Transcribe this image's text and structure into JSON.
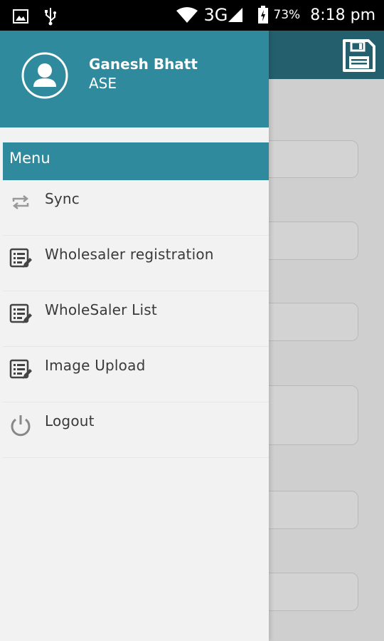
{
  "status_bar": {
    "network": "3G",
    "battery": "73%",
    "time": "8:18 pm"
  },
  "user": {
    "name": "Ganesh Bhatt",
    "role": "ASE"
  },
  "menu": {
    "title": "Menu",
    "items": [
      {
        "label": "Sync",
        "icon": "sync-icon"
      },
      {
        "label": "Wholesaler registration",
        "icon": "edit-list-icon"
      },
      {
        "label": "WholeSaler List",
        "icon": "edit-list-icon"
      },
      {
        "label": "Image Upload",
        "icon": "edit-list-icon"
      },
      {
        "label": "Logout",
        "icon": "power-icon"
      }
    ]
  },
  "colors": {
    "accent": "#2e8a9c",
    "toolbar": "#245f6d"
  }
}
